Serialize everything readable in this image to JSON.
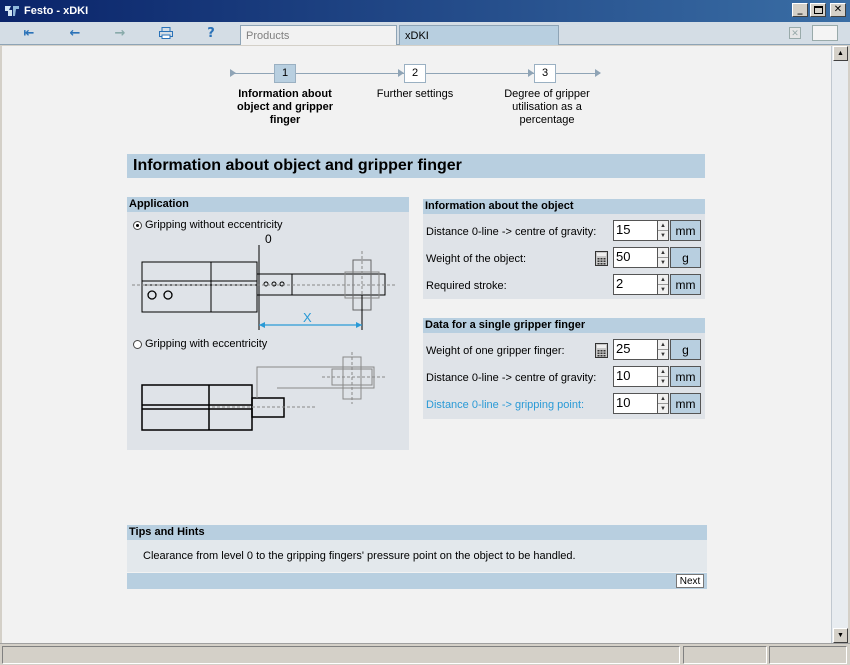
{
  "window": {
    "title": "Festo - xDKI"
  },
  "toolbar": {
    "tabs": [
      {
        "label": "Products"
      },
      {
        "label": "xDKI"
      }
    ]
  },
  "steps": [
    {
      "number": "1",
      "label": "Information about object and gripper finger",
      "active": true
    },
    {
      "number": "2",
      "label": "Further settings",
      "active": false
    },
    {
      "number": "3",
      "label": "Degree of gripper utilisation as a percentage",
      "active": false
    }
  ],
  "page_title": "Information about object and gripper finger",
  "application": {
    "heading": "Application",
    "option_1": "Gripping without eccentricity",
    "option_2": "Gripping with eccentricity",
    "diagram_zero": "0",
    "diagram_x": "X",
    "selected": 1
  },
  "object_info": {
    "heading": "Information about the object",
    "rows": [
      {
        "label": "Distance 0-line -> centre of gravity:",
        "value": "15",
        "unit": "mm"
      },
      {
        "label": "Weight of the object:",
        "value": "50",
        "unit": "g"
      },
      {
        "label": "Required stroke:",
        "value": "2",
        "unit": "mm"
      }
    ]
  },
  "finger_info": {
    "heading": "Data for a single gripper finger",
    "rows": [
      {
        "label": "Weight of one gripper finger:",
        "value": "25",
        "unit": "g"
      },
      {
        "label": "Distance 0-line -> centre of gravity:",
        "value": "10",
        "unit": "mm"
      },
      {
        "label": "Distance 0-line -> gripping point:",
        "value": "10",
        "unit": "mm"
      }
    ]
  },
  "tips": {
    "heading": "Tips and Hints",
    "text": "Clearance from level 0 to the gripping fingers' pressure point on the object to be handled.",
    "next_label": "Next"
  },
  "colors": {
    "accent": "#b8cfe0",
    "panel": "#dfe3e8",
    "link": "#2a9ad6",
    "titlebar": "#0a246a"
  }
}
